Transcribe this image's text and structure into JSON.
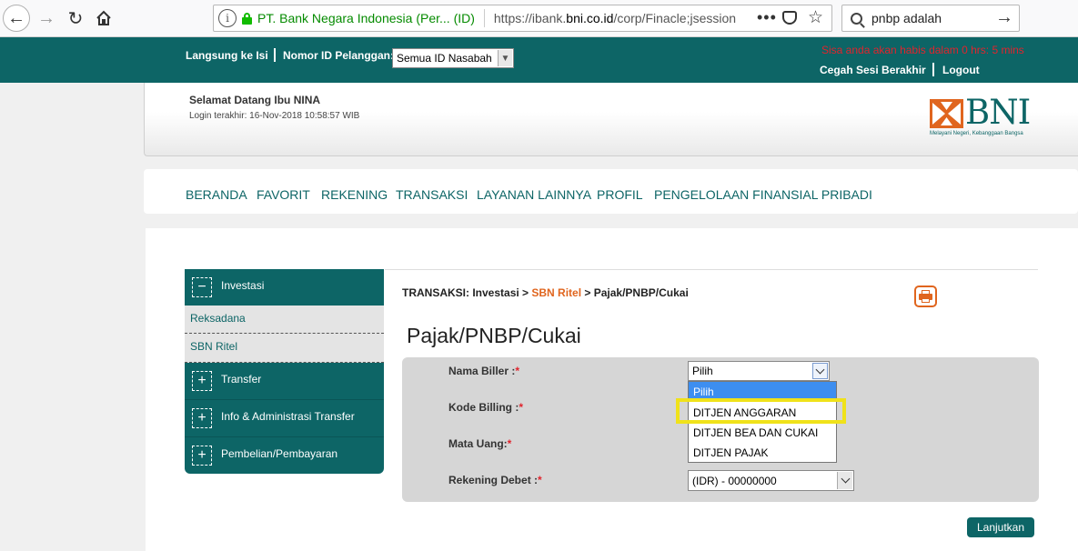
{
  "browser": {
    "url_org": "PT. Bank Negara Indonesia (Per... (ID)",
    "url_prefix": "https://ibank.",
    "url_domain": "bni.co.id",
    "url_suffix": "/corp/Finacle;jsession",
    "search_value": "pnbp adalah"
  },
  "topbar": {
    "skip_link": "Langsung ke Isi",
    "customer_id_label": "Nomor ID Pelanggan:",
    "customer_id_value": "Semua ID Nasabah",
    "session_text": "Sisa anda akan habis dalam 0 hrs: 5 mins",
    "keep_session": "Cegah Sesi Berakhir",
    "logout": "Logout"
  },
  "welcome": {
    "greeting": "Selamat Datang Ibu  NINA",
    "last_login": "Login terakhir:   16-Nov-2018 10:58:57  WIB",
    "logo_text": "BNI",
    "logo_tagline": "Melayani Negeri, Kebanggaan Bangsa"
  },
  "menu": [
    "BERANDA",
    "FAVORIT",
    "REKENING",
    "TRANSAKSI",
    "LAYANAN LAINNYA",
    "PROFIL",
    "PENGELOLAAN FINANSIAL PRIBADI"
  ],
  "sidebar": {
    "investasi": "Investasi",
    "investasi_items": [
      "Reksadana",
      "SBN Ritel"
    ],
    "groups": [
      "Transfer",
      "Info & Administrasi Transfer",
      "Pembelian/Pembayaran"
    ],
    "minus_symbol": "−",
    "plus_symbol": "+"
  },
  "breadcrumb": {
    "prefix": "TRANSAKSI: Investasi > ",
    "link": "SBN Ritel",
    "suffix": " > Pajak/PNBP/Cukai"
  },
  "page_title": "Pajak/PNBP/Cukai",
  "form": {
    "biller_label": "Nama Biller :",
    "billing_code_label": "Kode Billing :",
    "currency_label": "Mata Uang:",
    "debit_account_label": "Rekening Debet :",
    "required_mark": "*",
    "biller_value": "Pilih",
    "biller_options": [
      "Pilih",
      "DITJEN ANGGARAN",
      "DITJEN BEA DAN CUKAI",
      "DITJEN PAJAK"
    ],
    "debit_account_value": "(IDR) - 00000000",
    "submit_label": "Lanjutkan"
  },
  "colors": {
    "brand_teal": "#0d6566",
    "brand_orange": "#e0651e",
    "highlight_yellow": "#f0e21a",
    "session_red": "#e0242d"
  }
}
